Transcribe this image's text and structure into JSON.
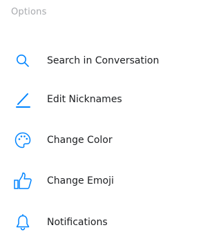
{
  "options": {
    "title": "Options",
    "items": [
      {
        "label": "Search in Conversation",
        "icon": "search-icon"
      },
      {
        "label": "Edit Nicknames",
        "icon": "pencil-icon"
      },
      {
        "label": "Change Color",
        "icon": "palette-icon"
      },
      {
        "label": "Change Emoji",
        "icon": "thumbs-up-icon"
      },
      {
        "label": "Notifications",
        "icon": "bell-icon"
      }
    ]
  },
  "colors": {
    "accent": "#0084ff",
    "text": "#1c1e21",
    "muted": "#a7a9ad"
  }
}
